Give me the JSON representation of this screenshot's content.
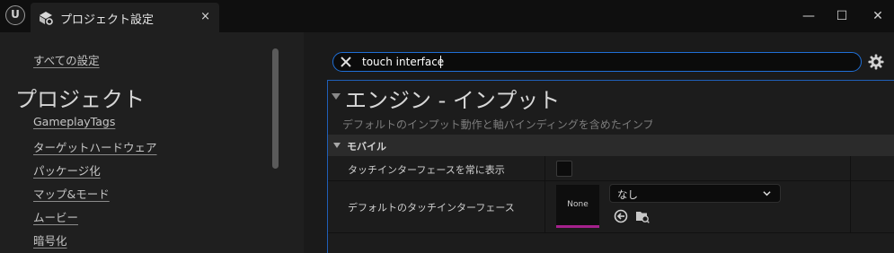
{
  "window": {
    "tab_title": "プロジェクト設定",
    "tab_close": "×",
    "controls": {
      "minimize": "—",
      "maximize": "☐",
      "close": "✕"
    },
    "logo_text": "U"
  },
  "sidebar": {
    "all_settings": "すべての設定",
    "section_title": "プロジェクト",
    "items": [
      {
        "label": "GameplayTags"
      },
      {
        "label": "ターゲットハードウェア"
      },
      {
        "label": "パッケージ化"
      },
      {
        "label": "マップ&モード"
      },
      {
        "label": "ムービー"
      },
      {
        "label": "暗号化"
      }
    ]
  },
  "search": {
    "value": "touch interface",
    "accent_color": "#1f6fd6"
  },
  "details": {
    "category_title": "エンジン - インプット",
    "category_description": "デフォルトのインプット動作と軸バインディングを含めたインプット",
    "subcategory": "モバイル",
    "rows": [
      {
        "label": "タッチインターフェースを常に表示",
        "checked": false
      },
      {
        "label": "デフォルトのタッチインターフェース",
        "thumbnail": "None",
        "combo_value": "なし"
      }
    ],
    "asset_color": "#a5218c"
  }
}
